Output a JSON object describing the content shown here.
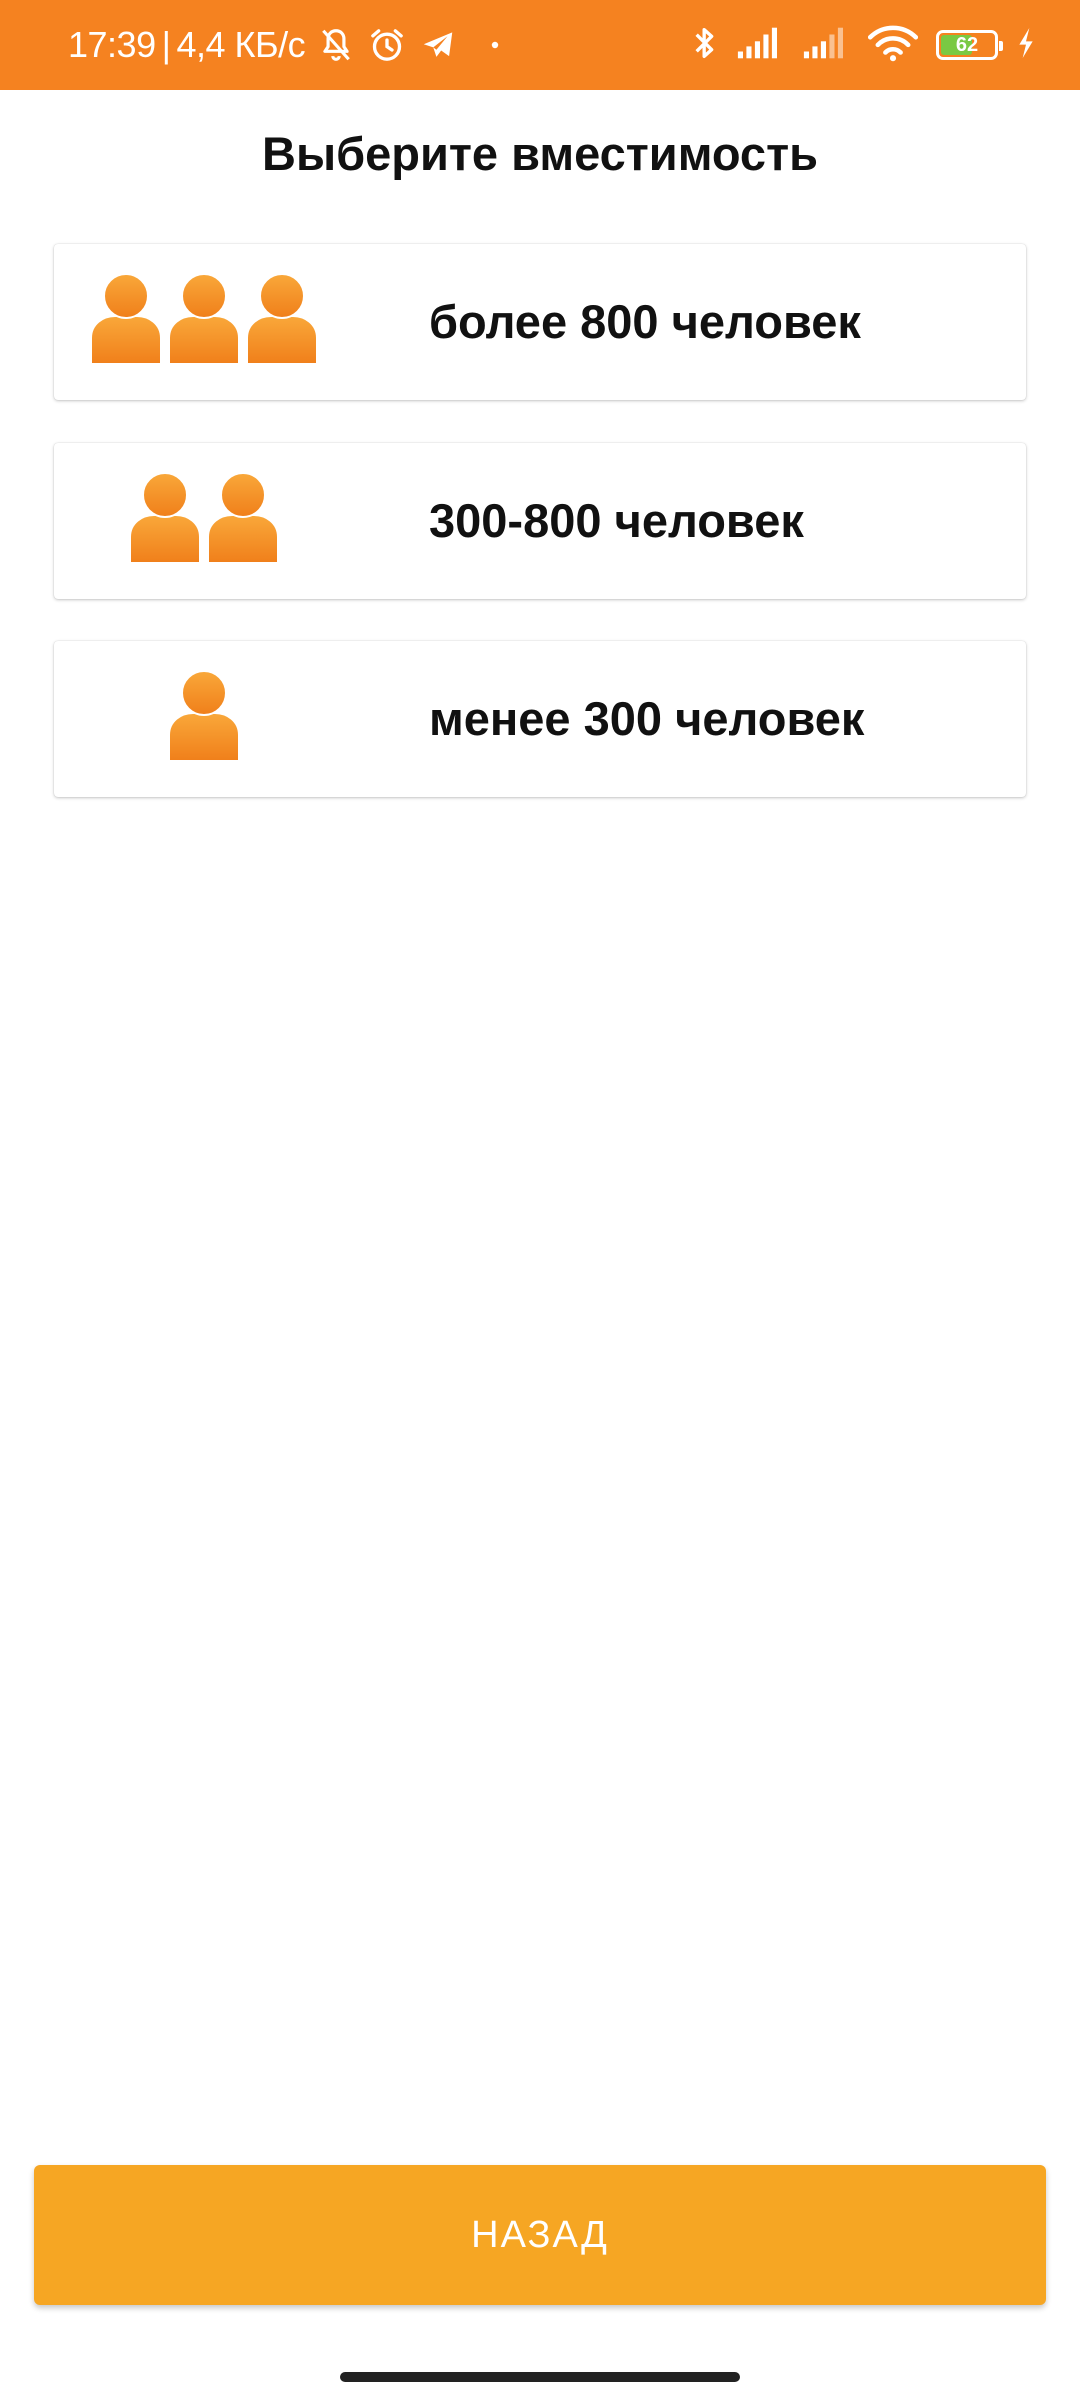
{
  "status_bar": {
    "time": "17:39",
    "separator": "|",
    "network_speed": "4,4 КБ/с",
    "battery_level": "62",
    "left_icons": [
      "bell-muted-icon",
      "alarm-clock-icon",
      "telegram-icon",
      "dot-icon"
    ],
    "right_icons": [
      "bluetooth-icon",
      "signal-icon",
      "signal-icon",
      "wifi-icon",
      "battery-icon",
      "charging-icon"
    ]
  },
  "page": {
    "title": "Выберите вместимость"
  },
  "options": [
    {
      "label": "более 800 человек",
      "icon": "person-icon",
      "icon_count": 3
    },
    {
      "label": "300-800 человек",
      "icon": "person-icon",
      "icon_count": 2
    },
    {
      "label": "менее 300 человек",
      "icon": "person-icon",
      "icon_count": 1
    }
  ],
  "back_button": {
    "label": "НАЗАД"
  },
  "colors": {
    "status_bar": "#f58220",
    "person_icon": "#f7931e",
    "button": "#f6a623",
    "battery_fill": "#7ac943"
  }
}
